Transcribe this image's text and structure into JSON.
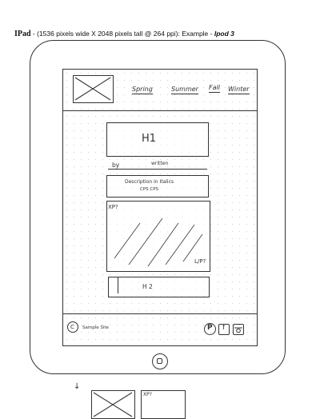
{
  "heading": {
    "device": "IPad",
    "dash": " - ",
    "spec": "(1536 pixels wide X 2048 pixels tall @ 264 ppi): Example - ",
    "example": "Ipod 3"
  },
  "nav": {
    "items": [
      "Spring",
      "Summer",
      "Fall",
      "Winter"
    ]
  },
  "content": {
    "h1": "H1",
    "byline_by": "by",
    "byline_name": "written",
    "description_line1": "Description in Italics",
    "description_line2": "CPS                    CPS",
    "image_top_label": "XP?",
    "image_bottom_label": "L/P?",
    "h2": "H 2"
  },
  "footer": {
    "copyright_symbol": "C",
    "copyright_text": "Sample Site",
    "pinterest_letter": "P",
    "facebook_letter": "f"
  },
  "below": {
    "arrow": "↓",
    "label": "XP?"
  }
}
